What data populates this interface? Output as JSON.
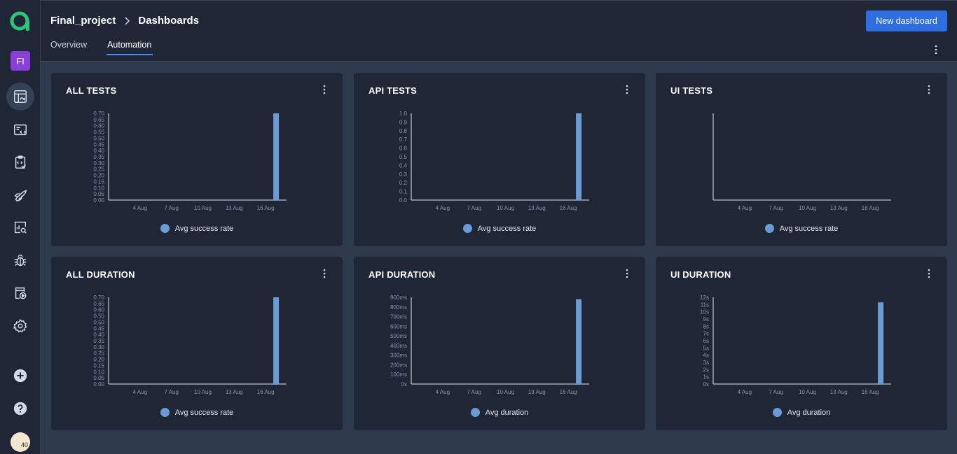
{
  "app": {
    "project_badge": "FI",
    "avatar_text": "40"
  },
  "header": {
    "breadcrumb": [
      "Final_project",
      "Dashboards"
    ],
    "tabs": [
      {
        "label": "Overview",
        "active": false
      },
      {
        "label": "Automation",
        "active": true
      }
    ],
    "new_dashboard_label": "New dashboard"
  },
  "sidebar": {
    "items": [
      {
        "icon": "dashboard-icon",
        "active": true
      },
      {
        "icon": "test-code-icon",
        "active": false
      },
      {
        "icon": "clipboard-check-icon",
        "active": false
      },
      {
        "icon": "rocket-icon",
        "active": false
      },
      {
        "icon": "report-search-icon",
        "active": false
      },
      {
        "icon": "bug-icon",
        "active": false
      },
      {
        "icon": "test-run-icon",
        "active": false
      },
      {
        "icon": "gear-icon",
        "active": false
      }
    ],
    "bottom_items": [
      {
        "icon": "plus-circle-icon"
      },
      {
        "icon": "help-icon"
      }
    ]
  },
  "colors": {
    "accent": "#2f6ee0",
    "bar": "#6a9bd4",
    "card_bg": "#1f2736",
    "page_bg": "#2d3a4b"
  },
  "cards": [
    {
      "title": "ALL TESTS",
      "legend": "Avg success rate"
    },
    {
      "title": "API TESTS",
      "legend": "Avg success rate"
    },
    {
      "title": "UI TESTS",
      "legend": "Avg success rate"
    },
    {
      "title": "ALL DURATION",
      "legend": "Avg success rate"
    },
    {
      "title": "API DURATION",
      "legend": "Avg duration"
    },
    {
      "title": "UI DURATION",
      "legend": "Avg duration"
    }
  ],
  "chart_data": [
    {
      "type": "bar",
      "x_ticks": [
        "4 Aug",
        "7 Aug",
        "10 Aug",
        "13 Aug",
        "16 Aug"
      ],
      "y_ticks": [
        "0.00",
        "0.05",
        "0.10",
        "0.15",
        "0.20",
        "0.25",
        "0.30",
        "0.35",
        "0.40",
        "0.45",
        "0.50",
        "0.55",
        "0.60",
        "0.65",
        "0.70"
      ],
      "ylim": [
        0,
        0.7
      ],
      "series": [
        {
          "name": "Avg success rate",
          "points": [
            {
              "x": "17 Aug",
              "y": 0.7
            }
          ]
        }
      ]
    },
    {
      "type": "bar",
      "x_ticks": [
        "4 Aug",
        "7 Aug",
        "10 Aug",
        "13 Aug",
        "16 Aug"
      ],
      "y_ticks": [
        "0.0",
        "0.1",
        "0.2",
        "0.3",
        "0.4",
        "0.5",
        "0.6",
        "0.7",
        "0.8",
        "0.9",
        "1.0"
      ],
      "ylim": [
        0,
        1.0
      ],
      "series": [
        {
          "name": "Avg success rate",
          "points": [
            {
              "x": "17 Aug",
              "y": 1.0
            }
          ]
        }
      ]
    },
    {
      "type": "bar",
      "x_ticks": [
        "4 Aug",
        "7 Aug",
        "10 Aug",
        "13 Aug",
        "16 Aug"
      ],
      "y_ticks": [],
      "ylim": [
        0,
        1
      ],
      "series": [
        {
          "name": "Avg success rate",
          "points": []
        }
      ]
    },
    {
      "type": "bar",
      "x_ticks": [
        "4 Aug",
        "7 Aug",
        "10 Aug",
        "13 Aug",
        "16 Aug"
      ],
      "y_ticks": [
        "0.00",
        "0.05",
        "0.10",
        "0.15",
        "0.20",
        "0.25",
        "0.30",
        "0.35",
        "0.40",
        "0.45",
        "0.50",
        "0.55",
        "0.60",
        "0.65",
        "0.70"
      ],
      "ylim": [
        0,
        0.7
      ],
      "series": [
        {
          "name": "Avg success rate",
          "points": [
            {
              "x": "17 Aug",
              "y": 0.7
            }
          ]
        }
      ]
    },
    {
      "type": "bar",
      "x_ticks": [
        "4 Aug",
        "7 Aug",
        "10 Aug",
        "13 Aug",
        "16 Aug"
      ],
      "y_ticks": [
        "0s",
        "100ms",
        "200ms",
        "300ms",
        "400ms",
        "500ms",
        "600ms",
        "700ms",
        "800ms",
        "900ms"
      ],
      "ylim": [
        0,
        900
      ],
      "series": [
        {
          "name": "Avg duration",
          "points": [
            {
              "x": "17 Aug",
              "y": 880
            }
          ]
        }
      ]
    },
    {
      "type": "bar",
      "x_ticks": [
        "4 Aug",
        "7 Aug",
        "10 Aug",
        "13 Aug",
        "16 Aug"
      ],
      "y_ticks": [
        "0s",
        "1s",
        "2s",
        "3s",
        "4s",
        "5s",
        "6s",
        "7s",
        "8s",
        "9s",
        "10s",
        "11s",
        "12s"
      ],
      "ylim": [
        0,
        12
      ],
      "series": [
        {
          "name": "Avg duration",
          "points": [
            {
              "x": "17 Aug",
              "y": 11.3
            }
          ]
        }
      ]
    }
  ]
}
